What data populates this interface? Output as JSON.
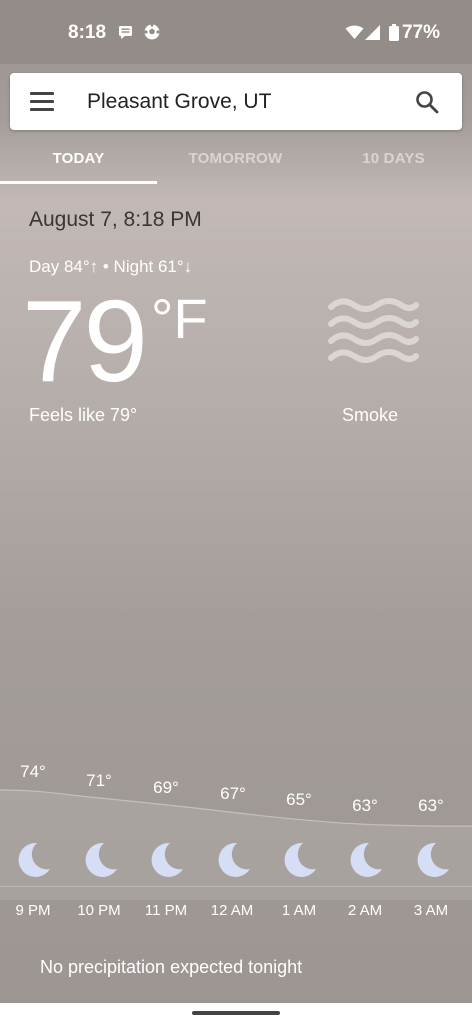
{
  "status_bar": {
    "time": "8:18",
    "battery": "77%",
    "icons": [
      "message-icon",
      "soccer-ball-icon",
      "wifi-icon",
      "signal-icon",
      "battery-icon"
    ]
  },
  "search": {
    "location": "Pleasant Grove, UT",
    "menu_icon": "menu-icon",
    "search_icon": "search-icon"
  },
  "tabs": [
    {
      "label": "TODAY",
      "active": true
    },
    {
      "label": "TOMORROW",
      "active": false
    },
    {
      "label": "10 DAYS",
      "active": false
    }
  ],
  "current": {
    "date_time": "August 7, 8:18 PM",
    "day_night": "Day 84°↑ • Night 61°↓",
    "temperature": "79",
    "unit": "°F",
    "feels_like": "Feels like 79°",
    "condition": "Smoke",
    "condition_icon": "smoke-icon"
  },
  "hourly": [
    {
      "time": "9 PM",
      "temp": "74°",
      "icon": "moon-icon"
    },
    {
      "time": "10 PM",
      "temp": "71°",
      "icon": "moon-icon"
    },
    {
      "time": "11 PM",
      "temp": "69°",
      "icon": "moon-icon"
    },
    {
      "time": "12 AM",
      "temp": "67°",
      "icon": "moon-icon"
    },
    {
      "time": "1 AM",
      "temp": "65°",
      "icon": "moon-icon"
    },
    {
      "time": "2 AM",
      "temp": "63°",
      "icon": "moon-icon"
    },
    {
      "time": "3 AM",
      "temp": "63°",
      "icon": "moon-icon"
    }
  ],
  "precipitation_note": "No precipitation expected tonight",
  "colors": {
    "moon": "#d6def5",
    "tab_active": "#ffffff",
    "date_text": "#3b3533"
  }
}
